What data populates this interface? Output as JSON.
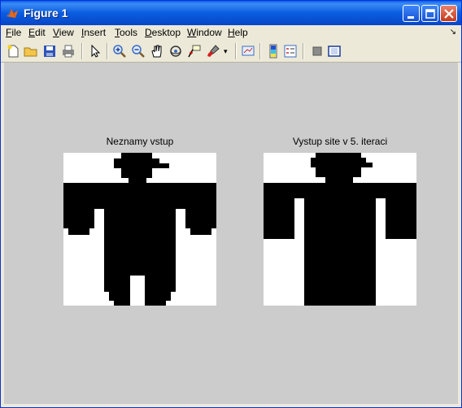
{
  "window": {
    "title": "Figure 1"
  },
  "menu": [
    "File",
    "Edit",
    "View",
    "Insert",
    "Tools",
    "Desktop",
    "Window",
    "Help"
  ],
  "toolbar": {
    "buttons": [
      "new-figure",
      "open-file",
      "save-figure",
      "print-figure",
      "edit-plot",
      "zoom-in",
      "zoom-out",
      "pan",
      "rotate-3d",
      "data-cursor",
      "brush",
      "link-plot",
      "insert-colorbar",
      "insert-legend",
      "hide-plot-tools",
      "show-plot-tools"
    ]
  },
  "figure": {
    "background": "#cccccc",
    "axes": [
      {
        "title": "Neznamy vstup",
        "image": "unknown-input-figure"
      },
      {
        "title": "Vystup site v 5. iteraci",
        "image": "network-output-figure"
      }
    ]
  }
}
